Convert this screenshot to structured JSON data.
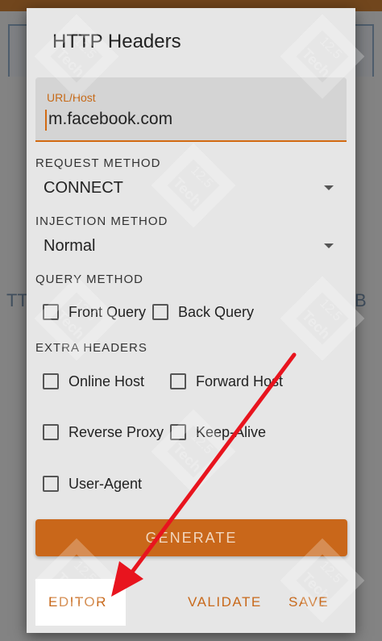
{
  "background": {
    "tab_left": "TT",
    "tab_right": "B"
  },
  "dialog": {
    "title": "HTTP Headers",
    "url_field": {
      "label": "URL/Host",
      "value": "m.facebook.com"
    },
    "request_method": {
      "label": "REQUEST METHOD",
      "selected": "CONNECT"
    },
    "injection_method": {
      "label": "INJECTION METHOD",
      "selected": "Normal"
    },
    "query_method": {
      "label": "QUERY METHOD",
      "options": [
        "Front Query",
        "Back Query"
      ]
    },
    "extra_headers": {
      "label": "EXTRA HEADERS",
      "options": [
        "Online Host",
        "Forward Host",
        "Reverse Proxy",
        "Keep-Alive",
        "User-Agent"
      ]
    },
    "generate_label": "GENERATE",
    "actions": {
      "editor": "EDITOR",
      "validate": "VALIDATE",
      "save": "SAVE"
    }
  },
  "watermark": {
    "line1": "12.5",
    "line2": "Tech"
  },
  "colors": {
    "accent": "#c9671a",
    "annotation_arrow": "#e8141e",
    "highlight": "#ffffff"
  }
}
